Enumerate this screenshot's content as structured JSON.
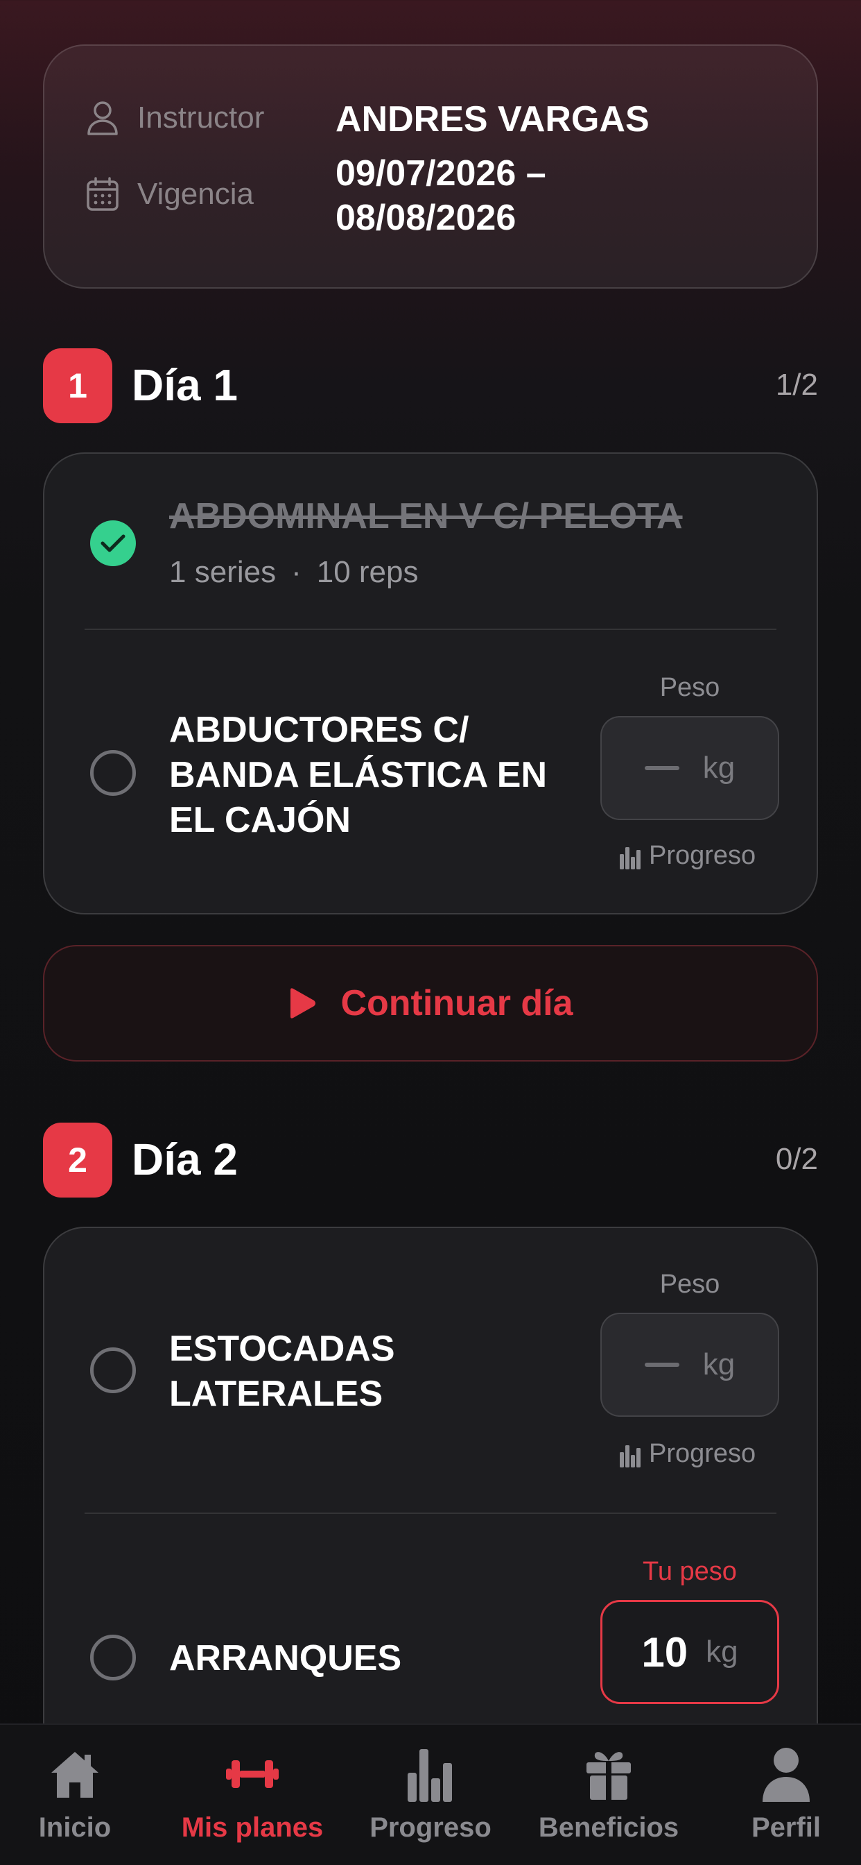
{
  "info": {
    "instructor_label": "Instructor",
    "instructor_value": "ANDRES VARGAS",
    "vigencia_label": "Vigencia",
    "vigencia_line1": "09/07/2026 –",
    "vigencia_line2": "08/08/2026"
  },
  "days": [
    {
      "badge": "1",
      "title": "Día 1",
      "count": "1/2",
      "exercises": [
        {
          "name": "ABDOMINAL EN V C/ PELOTA",
          "done": true,
          "series": "1 series",
          "dot": "·",
          "reps": "10 reps"
        },
        {
          "name_line1": "ABDUCTORES C/",
          "name_line2": "BANDA ELÁSTICA EN",
          "name_line3": "EL CAJÓN",
          "done": false,
          "weight_label": "Peso",
          "weight_unit": "kg",
          "progress_label": "Progreso"
        }
      ],
      "continue_label": "Continuar día"
    },
    {
      "badge": "2",
      "title": "Día 2",
      "count": "0/2",
      "exercises": [
        {
          "name_line1": "ESTOCADAS",
          "name_line2": "LATERALES",
          "done": false,
          "weight_label": "Peso",
          "weight_unit": "kg",
          "progress_label": "Progreso"
        },
        {
          "name": "ARRANQUES",
          "done": false,
          "weight_label": "Tu peso",
          "weight_value": "10",
          "weight_unit": "kg"
        }
      ]
    }
  ],
  "nav": {
    "items": [
      {
        "label": "Inicio",
        "icon": "home-icon"
      },
      {
        "label": "Mis planes",
        "icon": "dumbbell-icon",
        "active": true
      },
      {
        "label": "Progreso",
        "icon": "bar-chart-icon"
      },
      {
        "label": "Beneficios",
        "icon": "gift-icon"
      },
      {
        "label": "Perfil",
        "icon": "user-icon"
      }
    ]
  },
  "colors": {
    "accent": "#e63946",
    "success": "#35d08e",
    "background": "#121214"
  }
}
